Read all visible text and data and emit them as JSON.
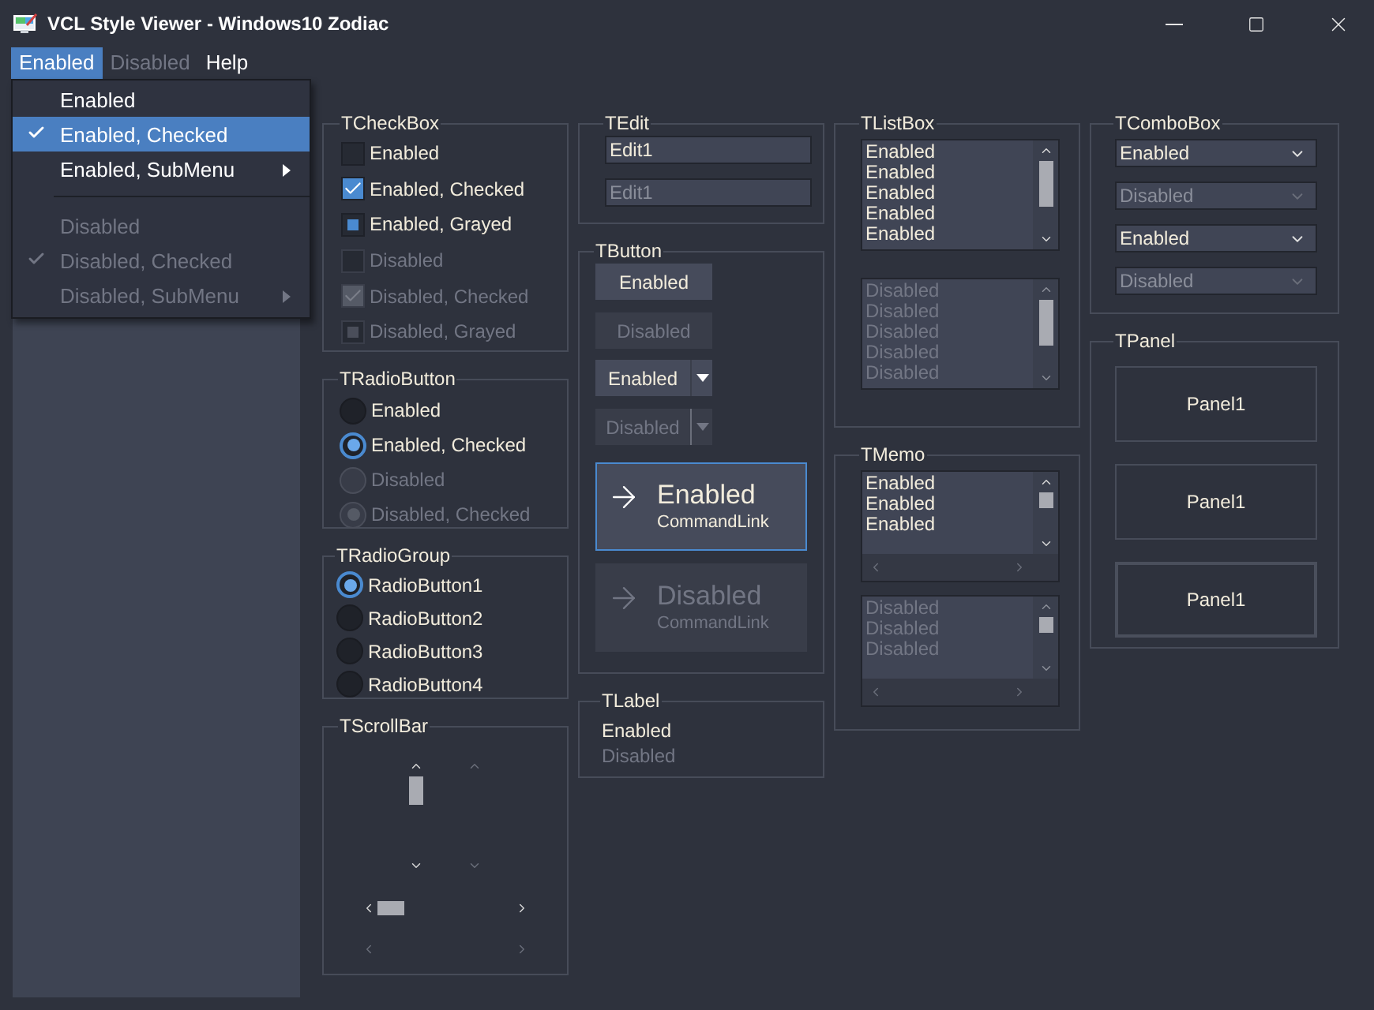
{
  "window": {
    "title": "VCL Style Viewer - Windows10 Zodiac"
  },
  "menu_bar": [
    {
      "label": "Enabled",
      "selected": true,
      "disabled": false
    },
    {
      "label": "Disabled",
      "selected": false,
      "disabled": true
    },
    {
      "label": "Help",
      "selected": false,
      "disabled": false
    }
  ],
  "dropdown": [
    {
      "kind": "item",
      "label": "Enabled",
      "checked": false,
      "disabled": false,
      "submenu": false,
      "selected": false
    },
    {
      "kind": "item",
      "label": "Enabled, Checked",
      "checked": true,
      "disabled": false,
      "submenu": false,
      "selected": true
    },
    {
      "kind": "item",
      "label": "Enabled, SubMenu",
      "checked": false,
      "disabled": false,
      "submenu": true,
      "selected": false
    },
    {
      "kind": "separator"
    },
    {
      "kind": "item",
      "label": "Disabled",
      "checked": false,
      "disabled": true,
      "submenu": false,
      "selected": false
    },
    {
      "kind": "item",
      "label": "Disabled, Checked",
      "checked": true,
      "disabled": true,
      "submenu": false,
      "selected": false
    },
    {
      "kind": "item",
      "label": "Disabled, SubMenu",
      "checked": false,
      "disabled": true,
      "submenu": true,
      "selected": false
    }
  ],
  "checkboxes": {
    "title": "TCheckBox",
    "items": [
      {
        "label": "Enabled",
        "checked": false,
        "grayed": false,
        "disabled": false
      },
      {
        "label": "Enabled, Checked",
        "checked": true,
        "grayed": false,
        "disabled": false
      },
      {
        "label": "Enabled, Grayed",
        "checked": false,
        "grayed": true,
        "disabled": false
      },
      {
        "label": "Disabled",
        "checked": false,
        "grayed": false,
        "disabled": true
      },
      {
        "label": "Disabled, Checked",
        "checked": true,
        "grayed": false,
        "disabled": true
      },
      {
        "label": "Disabled, Grayed",
        "checked": false,
        "grayed": true,
        "disabled": true
      }
    ]
  },
  "radio_buttons": {
    "title": "TRadioButton",
    "items": [
      {
        "label": "Enabled",
        "checked": false,
        "disabled": false
      },
      {
        "label": "Enabled, Checked",
        "checked": true,
        "disabled": false
      },
      {
        "label": "Disabled",
        "checked": false,
        "disabled": true
      },
      {
        "label": "Disabled, Checked",
        "checked": true,
        "disabled": true
      }
    ]
  },
  "radio_group": {
    "title": "TRadioGroup",
    "items": [
      {
        "label": "RadioButton1",
        "selected": true
      },
      {
        "label": "RadioButton2",
        "selected": false
      },
      {
        "label": "RadioButton3",
        "selected": false
      },
      {
        "label": "RadioButton4",
        "selected": false
      }
    ]
  },
  "scroll_bars": {
    "title": "TScrollBar",
    "vertical": [
      {
        "disabled": false
      },
      {
        "disabled": true
      }
    ],
    "horizontal": [
      {
        "disabled": false
      },
      {
        "disabled": true
      }
    ]
  },
  "edits": {
    "title": "TEdit",
    "items": [
      {
        "value": "Edit1",
        "disabled": false
      },
      {
        "value": "Edit1",
        "disabled": true
      }
    ]
  },
  "buttons": {
    "title": "TButton",
    "items": [
      {
        "kind": "push",
        "label": "Enabled",
        "disabled": false
      },
      {
        "kind": "push",
        "label": "Disabled",
        "disabled": true
      },
      {
        "kind": "split",
        "label": "Enabled",
        "disabled": false
      },
      {
        "kind": "split",
        "label": "Disabled",
        "disabled": true
      },
      {
        "kind": "command_link",
        "label": "Enabled",
        "note": "CommandLink",
        "disabled": false,
        "focused": true
      },
      {
        "kind": "command_link",
        "label": "Disabled",
        "note": "CommandLink",
        "disabled": true,
        "focused": false
      }
    ]
  },
  "labels": {
    "title": "TLabel",
    "items": [
      {
        "text": "Enabled",
        "disabled": false
      },
      {
        "text": "Disabled",
        "disabled": true
      }
    ]
  },
  "list_boxes": {
    "title": "TListBox",
    "items": [
      {
        "disabled": false,
        "lines": [
          "Enabled",
          "Enabled",
          "Enabled",
          "Enabled",
          "Enabled"
        ]
      },
      {
        "disabled": true,
        "lines": [
          "Disabled",
          "Disabled",
          "Disabled",
          "Disabled",
          "Disabled"
        ]
      }
    ]
  },
  "memos": {
    "title": "TMemo",
    "items": [
      {
        "disabled": false,
        "lines": [
          "Enabled",
          "Enabled",
          "Enabled"
        ]
      },
      {
        "disabled": true,
        "lines": [
          "Disabled",
          "Disabled",
          "Disabled"
        ]
      }
    ]
  },
  "combo_boxes": {
    "title": "TComboBox",
    "items": [
      {
        "value": "Enabled",
        "disabled": false
      },
      {
        "value": "Disabled",
        "disabled": true
      },
      {
        "value": "Enabled",
        "disabled": false
      },
      {
        "value": "Disabled",
        "disabled": true
      }
    ]
  },
  "panels": {
    "title": "TPanel",
    "items": [
      {
        "caption": "Panel1",
        "kind": "flat"
      },
      {
        "caption": "Panel1",
        "kind": "flat"
      },
      {
        "caption": "Panel1",
        "kind": "raised"
      }
    ]
  }
}
